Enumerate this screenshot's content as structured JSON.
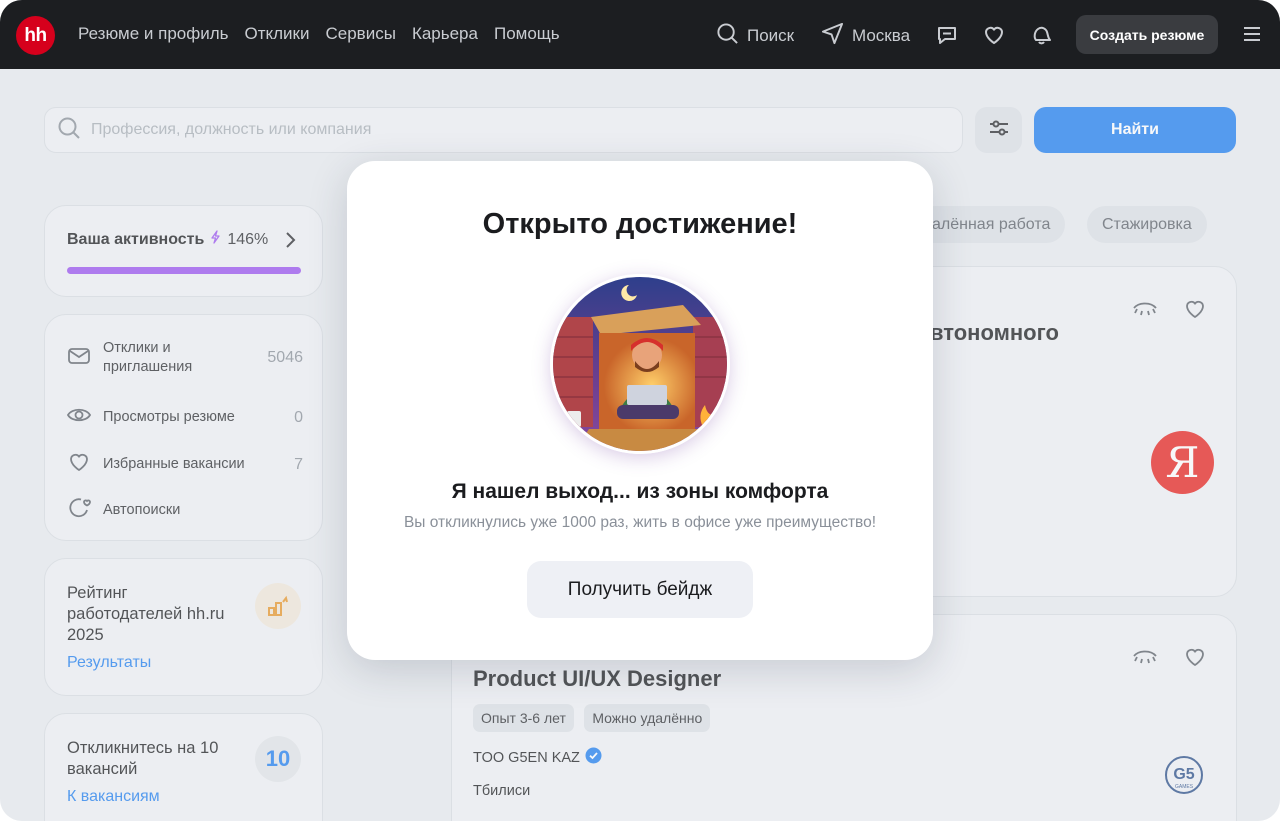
{
  "header": {
    "logo": "hh",
    "nav": [
      "Резюме и профиль",
      "Отклики",
      "Сервисы",
      "Карьера",
      "Помощь"
    ],
    "search_label": "Поиск",
    "city": "Москва",
    "create_resume": "Создать резюме"
  },
  "search": {
    "placeholder": "Профессия, должность или компания",
    "find_label": "Найти"
  },
  "activity": {
    "label": "Ваша активность",
    "percent": "146%",
    "progress": 1.0,
    "accent": "#9a52f0"
  },
  "stats": [
    {
      "icon": "envelope-icon",
      "label": "Отклики и приглашения",
      "count": "5046"
    },
    {
      "icon": "eye-icon",
      "label": "Просмотры резюме",
      "count": "0"
    },
    {
      "icon": "heart-icon",
      "label": "Избранные вакансии",
      "count": "7"
    },
    {
      "icon": "autosearch-icon",
      "label": "Автопоиски",
      "count": ""
    }
  ],
  "rating": {
    "text": "Рейтинг работодателей hh.ru 2025",
    "link": "Результаты"
  },
  "respond": {
    "text": "Откликнитесь на 10 вакансий",
    "number": "10",
    "link": "К вакансиям"
  },
  "chips": [
    "алённая работа",
    "Стажировка"
  ],
  "vacancies": [
    {
      "title_fragment": "втономного",
      "logo": "Я"
    },
    {
      "title": "Product UI/UX Designer",
      "tags": [
        "Опыт 3-6 лет",
        "Можно удалённо"
      ],
      "company": "TOO G5EN KAZ",
      "city": "Тбилиси",
      "logo": "G5 GAMES"
    }
  ],
  "modal": {
    "title": "Открыто достижение!",
    "subtitle": "Я нашел выход... из зоны комфорта",
    "description": "Вы откликнулись уже 1000 раз, жить в офисе уже преимущество!",
    "button": "Получить бейдж"
  },
  "colors": {
    "brand_red": "#d6001c",
    "primary_blue": "#1f7ef0",
    "header_bg": "#1c1e21"
  }
}
